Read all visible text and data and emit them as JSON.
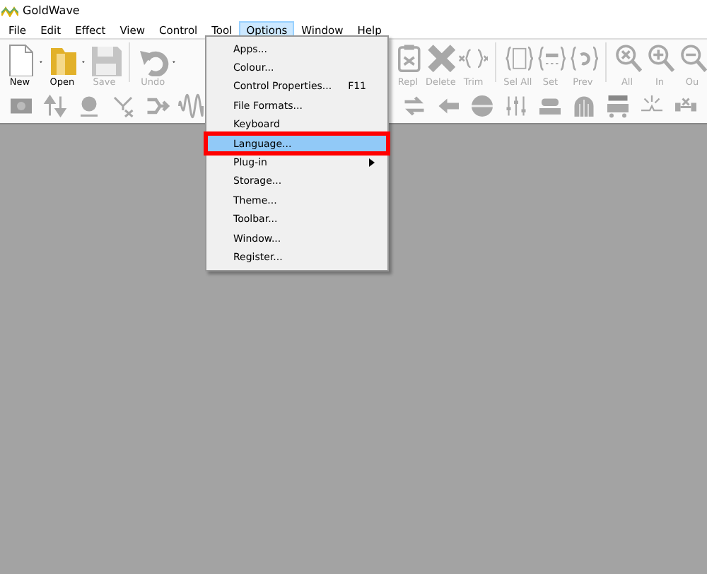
{
  "window": {
    "title": "GoldWave"
  },
  "menu_bar": [
    {
      "label": "File",
      "selected": false
    },
    {
      "label": "Edit",
      "selected": false
    },
    {
      "label": "Effect",
      "selected": false
    },
    {
      "label": "View",
      "selected": false
    },
    {
      "label": "Control",
      "selected": false
    },
    {
      "label": "Tool",
      "selected": false
    },
    {
      "label": "Options",
      "selected": true
    },
    {
      "label": "Window",
      "selected": false
    },
    {
      "label": "Help",
      "selected": false
    }
  ],
  "toolbar_left": [
    {
      "label": "New",
      "disabled": false,
      "dropdown": true
    },
    {
      "label": "Open",
      "disabled": false,
      "dropdown": true
    },
    {
      "label": "Save",
      "disabled": true,
      "dropdown": false
    },
    {
      "label": "Undo",
      "disabled": true,
      "dropdown": true
    }
  ],
  "toolbar_right": [
    {
      "label": "Repl",
      "disabled": true
    },
    {
      "label": "Delete",
      "disabled": true
    },
    {
      "label": "Trim",
      "disabled": true
    },
    {
      "label": "Sel All",
      "disabled": true
    },
    {
      "label": "Set",
      "disabled": true
    },
    {
      "label": "Prev",
      "disabled": true
    },
    {
      "label": "All",
      "disabled": true
    },
    {
      "label": "In",
      "disabled": true
    },
    {
      "label": "Ou",
      "disabled": true
    }
  ],
  "options_menu": [
    {
      "label": "Apps...",
      "selected": false,
      "disabled": false,
      "marked": false
    },
    {
      "label": "Colour...",
      "selected": false,
      "disabled": false,
      "marked": false
    },
    {
      "label": "Control Properties...",
      "shortcut": "F11",
      "selected": false,
      "disabled": false,
      "marked": false
    },
    {
      "label": "File Formats...",
      "selected": false,
      "disabled": false,
      "marked": false
    },
    {
      "label": "Keyboard",
      "selected": false,
      "disabled": false,
      "marked": false
    },
    {
      "label": "Language...",
      "selected": true,
      "disabled": false,
      "marked": true
    },
    {
      "label": "Plug-in",
      "submenu": true,
      "selected": false,
      "disabled": false,
      "marked": false
    },
    {
      "label": "Storage...",
      "selected": false,
      "disabled": false,
      "marked": false
    },
    {
      "label": "Theme...",
      "selected": false,
      "disabled": false,
      "marked": false
    },
    {
      "label": "Toolbar...",
      "selected": false,
      "disabled": false,
      "marked": false
    },
    {
      "label": "Window...",
      "selected": false,
      "disabled": false,
      "marked": false
    },
    {
      "label": "Register...",
      "selected": false,
      "disabled": false,
      "marked": false
    }
  ]
}
